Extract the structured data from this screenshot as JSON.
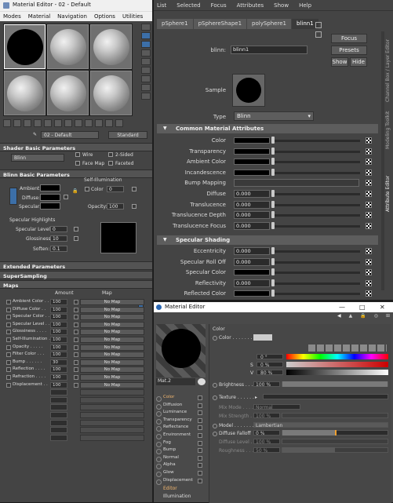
{
  "max_editor": {
    "title": "Material Editor - 02 - Default",
    "menu": [
      "Modes",
      "Material",
      "Navigation",
      "Options",
      "Utilities"
    ],
    "material_name": "02 - Default",
    "material_type": "Standard",
    "shader_params": {
      "header": "Shader Basic Parameters",
      "shader": "Blinn",
      "wire": "Wire",
      "two_sided": "2-Sided",
      "face_map": "Face Map",
      "faceted": "Faceted"
    },
    "blinn_params": {
      "header": "Blinn Basic Parameters",
      "ambient": "Ambient:",
      "diffuse": "Diffuse:",
      "specular": "Specular:",
      "self_illum": "Self-Illumination",
      "color": "Color",
      "color_val": "0",
      "opacity": "Opacity:",
      "opacity_val": "100",
      "spec_highlights": "Specular Highlights",
      "spec_level": "Specular Level:",
      "spec_level_val": "0",
      "glossiness": "Glossiness:",
      "glossiness_val": "10",
      "soften": "Soften:",
      "soften_val": "0.1"
    },
    "extended": "Extended Parameters",
    "supersampling": "SuperSampling",
    "maps": {
      "header": "Maps",
      "amount_col": "Amount",
      "map_col": "Map",
      "rows": [
        {
          "name": "Ambient Color . .",
          "amt": "100",
          "map": "No Map"
        },
        {
          "name": "Diffuse Color . .",
          "amt": "100",
          "map": "No Map"
        },
        {
          "name": "Specular Color . .",
          "amt": "100",
          "map": "No Map"
        },
        {
          "name": "Specular Level . .",
          "amt": "100",
          "map": "No Map"
        },
        {
          "name": "Glossiness . . . .",
          "amt": "100",
          "map": "No Map"
        },
        {
          "name": "Self-Illumination .",
          "amt": "100",
          "map": "No Map"
        },
        {
          "name": "Opacity . . . . .",
          "amt": "100",
          "map": "No Map"
        },
        {
          "name": "Filter Color . . .",
          "amt": "100",
          "map": "No Map"
        },
        {
          "name": "Bump . . . . . .",
          "amt": "30",
          "map": "No Map"
        },
        {
          "name": "Reflection . . . .",
          "amt": "100",
          "map": "No Map"
        },
        {
          "name": "Refraction . . . .",
          "amt": "100",
          "map": "No Map"
        },
        {
          "name": "Displacement . .",
          "amt": "100",
          "map": "No Map"
        }
      ]
    }
  },
  "maya_ae": {
    "menu": [
      "List",
      "Selected",
      "Focus",
      "Attributes",
      "Show",
      "Help"
    ],
    "tabs": [
      "pSphere1",
      "pSphereShape1",
      "polySphere1",
      "blinn1"
    ],
    "active_tab": "blinn1",
    "node_label": "blinn:",
    "node_name": "blinn1",
    "buttons": {
      "focus": "Focus",
      "presets": "Presets",
      "show": "Show",
      "hide": "Hide"
    },
    "sample_label": "Sample",
    "type_label": "Type",
    "type_value": "Blinn",
    "common_header": "Common Material Attributes",
    "common_attrs": [
      {
        "label": "Color",
        "kind": "swatch"
      },
      {
        "label": "Transparency",
        "kind": "swatch"
      },
      {
        "label": "Ambient Color",
        "kind": "swatch"
      },
      {
        "label": "Incandescence",
        "kind": "swatch"
      },
      {
        "label": "Bump Mapping",
        "kind": "bump"
      },
      {
        "label": "Diffuse",
        "kind": "num",
        "value": "0.000"
      },
      {
        "label": "Translucence",
        "kind": "num",
        "value": "0.000"
      },
      {
        "label": "Translucence Depth",
        "kind": "num",
        "value": "0.000"
      },
      {
        "label": "Translucence Focus",
        "kind": "num",
        "value": "0.000"
      }
    ],
    "spec_header": "Specular Shading",
    "spec_attrs": [
      {
        "label": "Eccentricity",
        "kind": "num",
        "value": "0.000"
      },
      {
        "label": "Specular Roll Off",
        "kind": "num",
        "value": "0.000"
      },
      {
        "label": "Specular Color",
        "kind": "swatch"
      },
      {
        "label": "Reflectivity",
        "kind": "num",
        "value": "0.000"
      },
      {
        "label": "Reflected Color",
        "kind": "swatch"
      }
    ],
    "side_tabs": [
      "Channel Box / Layer Editor",
      "Modeling Toolkit",
      "Attribute Editor"
    ]
  },
  "c4d_editor": {
    "title": "Material Editor",
    "mat_name": "Mat.2",
    "channels": [
      {
        "name": "Color",
        "active": true
      },
      {
        "name": "Diffusion",
        "active": false
      },
      {
        "name": "Luminance",
        "active": false
      },
      {
        "name": "Transparency",
        "active": false
      },
      {
        "name": "Reflectance",
        "active": false
      },
      {
        "name": "Environment",
        "active": false
      },
      {
        "name": "Fog",
        "active": false
      },
      {
        "name": "Bump",
        "active": false
      },
      {
        "name": "Normal",
        "active": false
      },
      {
        "name": "Alpha",
        "active": false
      },
      {
        "name": "Glow",
        "active": false
      },
      {
        "name": "Displacement",
        "active": false
      }
    ],
    "footer": [
      "Editor",
      "Illumination"
    ],
    "section": "Color",
    "color_label": "Color . . . . . . . .",
    "h_label": "H",
    "h_value": "0 °",
    "s_label": "S",
    "s_value": "0 %",
    "v_label": "V",
    "v_value": "80 %",
    "brightness_label": "Brightness . . .",
    "brightness_value": "100 %",
    "brightness_pct": 100,
    "texture_label": "Texture . . . . . .",
    "mix_mode_label": "Mix Mode . . . .",
    "mix_mode_value": "Normal",
    "mix_strength_label": "Mix Strength . .",
    "mix_strength_value": "100 %",
    "model_label": "Model . . . . . . . .",
    "model_value": "Lambertian",
    "diffuse_falloff_label": "Diffuse Falloff",
    "diffuse_falloff_value": "0 %",
    "diffuse_falloff_pct": 50,
    "diffuse_level_label": "Diffuse Level . .",
    "diffuse_level_value": "100 %",
    "roughness_label": "Roughness . . . .",
    "roughness_value": "50 %",
    "roughness_pct": 50
  }
}
